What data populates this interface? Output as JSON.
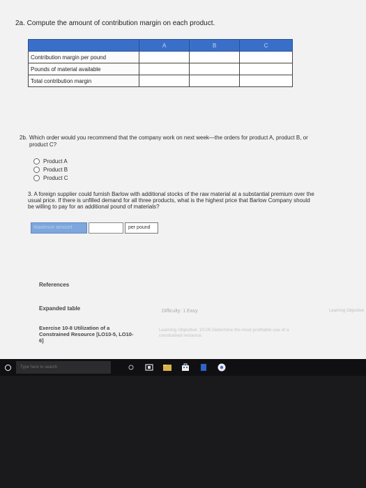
{
  "q2a": {
    "title": "2a. Compute the amount of contribution margin on each product."
  },
  "table": {
    "columns": [
      "A",
      "B",
      "C"
    ],
    "rows": [
      "Contribution margin per pound",
      "Pounds of material available",
      "Total contribution margin"
    ]
  },
  "q2b": {
    "number": "2b.",
    "text": "Which order would you recommend that the company work on next week—the orders for product A, product B, or product C?",
    "options": [
      "Product A",
      "Product B",
      "Product C"
    ]
  },
  "q3": {
    "text": "3. A foreign supplier could furnish Barlow with additional stocks of the raw material at a substantial premium over the usual price. If there is unfilled demand for all three products, what is the highest price that Barlow Company should be willing to pay for an additional pound of materials?",
    "label": "Maximum amount",
    "value": "",
    "unit": "per pound"
  },
  "footer": {
    "references": "References",
    "expanded": "Expanded table",
    "difficulty": "Difficulty: 1 Easy",
    "lo_label": "Learning Objective",
    "exercise": "Exercise 10-8 Utilization of a Constrained Resource [LO10-5, LO10-6]",
    "lo_text": "Learning Objective: 10-05 Determine the most profitable use of a constrained resource."
  },
  "taskbar": {
    "search_placeholder": "Type here to search",
    "icons": [
      "cortana-icon",
      "task-view-icon",
      "file-explorer-icon",
      "store-icon",
      "app-icon",
      "chrome-icon"
    ]
  }
}
